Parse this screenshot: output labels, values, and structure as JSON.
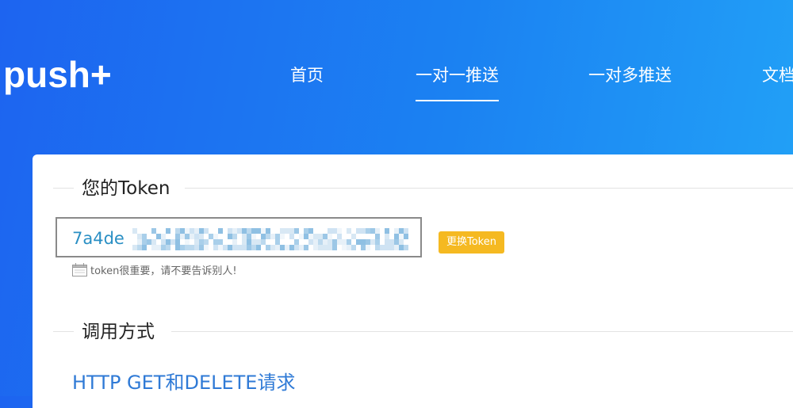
{
  "header": {
    "logo": "push+",
    "nav": [
      "首页",
      "一对一推送",
      "一对多推送",
      "文档"
    ],
    "active_nav": "一对一推送"
  },
  "token_section": {
    "title": "您的Token",
    "token_visible_prefix": "7a4de",
    "token_obscured": true,
    "change_button": "更换Token",
    "tip": "token很重要，请不要告诉别人!"
  },
  "usage_section": {
    "title": "调用方式",
    "link": "HTTP GET和DELETE请求"
  },
  "colors": {
    "header_gradient_start": "#1d64f0",
    "header_gradient_end": "#22a3f7",
    "token_text": "#2a8fc4",
    "change_button_bg": "#f5b921",
    "link": "#2f7ad6"
  }
}
